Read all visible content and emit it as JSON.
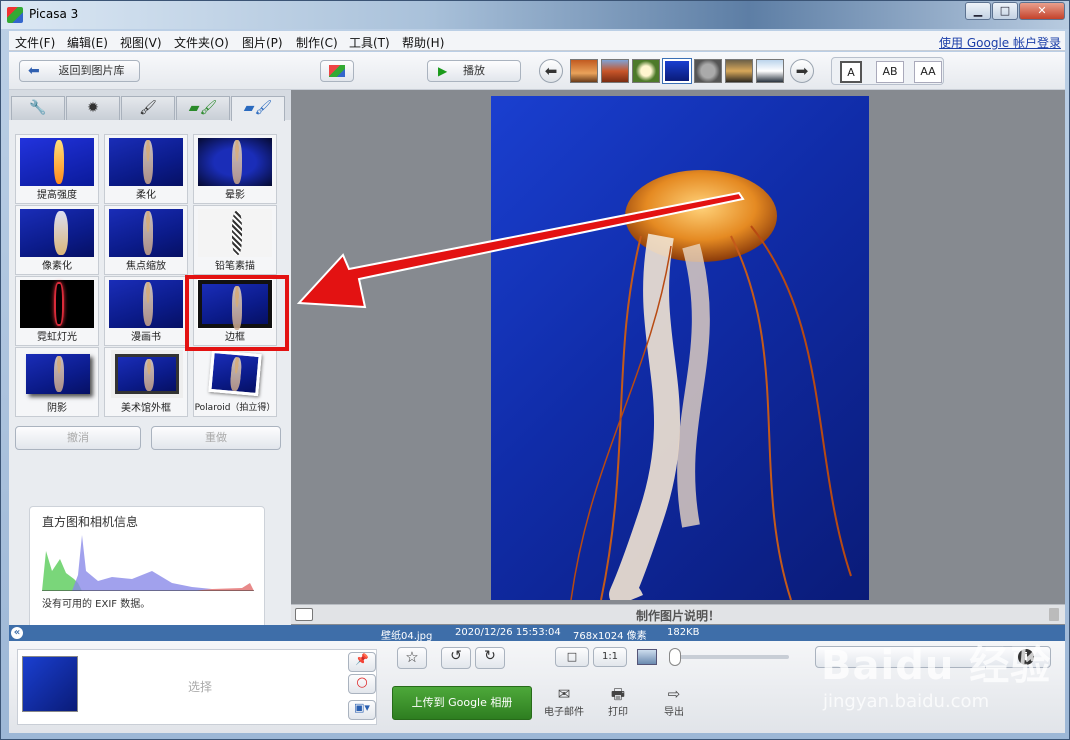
{
  "window": {
    "title": "Picasa 3",
    "min": "▁",
    "max": "□",
    "close": "✕"
  },
  "menu": [
    "文件(F)",
    "编辑(E)",
    "视图(V)",
    "文件夹(O)",
    "图片(P)",
    "制作(C)",
    "工具(T)",
    "帮助(H)"
  ],
  "signin": "使用 Google 帐户登录",
  "toolbar": {
    "back_label": "返回到图片库",
    "play_label": "播放",
    "layout_labels": [
      "A",
      "AB",
      "AA"
    ]
  },
  "tabs": [
    "wrench-icon",
    "brightness-icon",
    "brush-icon",
    "brush-green-icon",
    "brush-blue-icon"
  ],
  "effects": [
    {
      "label": "提高强度"
    },
    {
      "label": "柔化"
    },
    {
      "label": "晕影"
    },
    {
      "label": "像素化"
    },
    {
      "label": "焦点缩放"
    },
    {
      "label": "铅笔素描"
    },
    {
      "label": "霓虹灯光"
    },
    {
      "label": "漫画书"
    },
    {
      "label": "边框"
    },
    {
      "label": "阴影"
    },
    {
      "label": "美术馆外框"
    },
    {
      "label": "Polaroid（拍立得）"
    }
  ],
  "undo_label": "撤消",
  "redo_label": "重做",
  "histogram": {
    "title": "直方图和相机信息",
    "exif": "没有可用的 EXIF 数据。"
  },
  "caption": "制作图片说明！",
  "status": {
    "file": "壁纸04.jpg",
    "date": "2020/12/26 15:53:04",
    "dims": "768x1024 像素",
    "size": "182KB"
  },
  "tray_label": "选择",
  "upload_label": "上传到 Google 相册",
  "actions": [
    {
      "label": "电子邮件",
      "icon": "email-icon"
    },
    {
      "label": "打印",
      "icon": "print-icon"
    },
    {
      "label": "导出",
      "icon": "export-icon"
    }
  ],
  "zoom_buttons": [
    "□",
    "1:1"
  ],
  "watermark": {
    "main": "Baidu 经验",
    "sub": "jingyan.baidu.com"
  },
  "colors": {
    "highlight": "#e31212",
    "statusbar": "#3e6ea9",
    "upload": "#2e7e20"
  }
}
